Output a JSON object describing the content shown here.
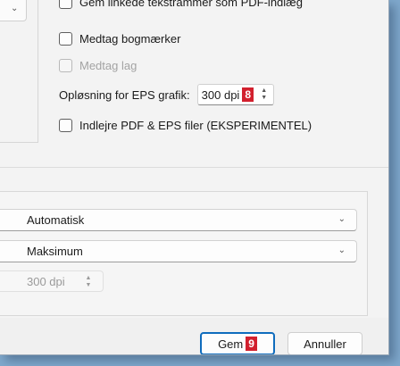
{
  "options": {
    "embed_text_frames": "Gem linkede tekstrammer som PDF-indlæg",
    "include_bookmarks": "Medtag bogmærker",
    "include_layers": "Medtag lag",
    "eps_resolution_label": "Opløsning for EPS grafik:",
    "eps_resolution_value": "300 dpi",
    "eps_resolution_badge": "8",
    "embed_pdf_eps": "Indlejre PDF & EPS filer (EKSPERIMENTEL)"
  },
  "section2": {
    "select1_value": "Automatisk",
    "select2_value": "Maksimum",
    "dpi_value": "300 dpi"
  },
  "footer": {
    "save_label": "Gem",
    "save_badge": "9",
    "cancel_label": "Annuller"
  },
  "icons": {
    "chevron": "chevron-down-icon",
    "spin": "spin-updown-icon"
  },
  "colors": {
    "accent": "#0f6cbd",
    "badge": "#d2202e",
    "backdrop": "#7fa8cc"
  }
}
